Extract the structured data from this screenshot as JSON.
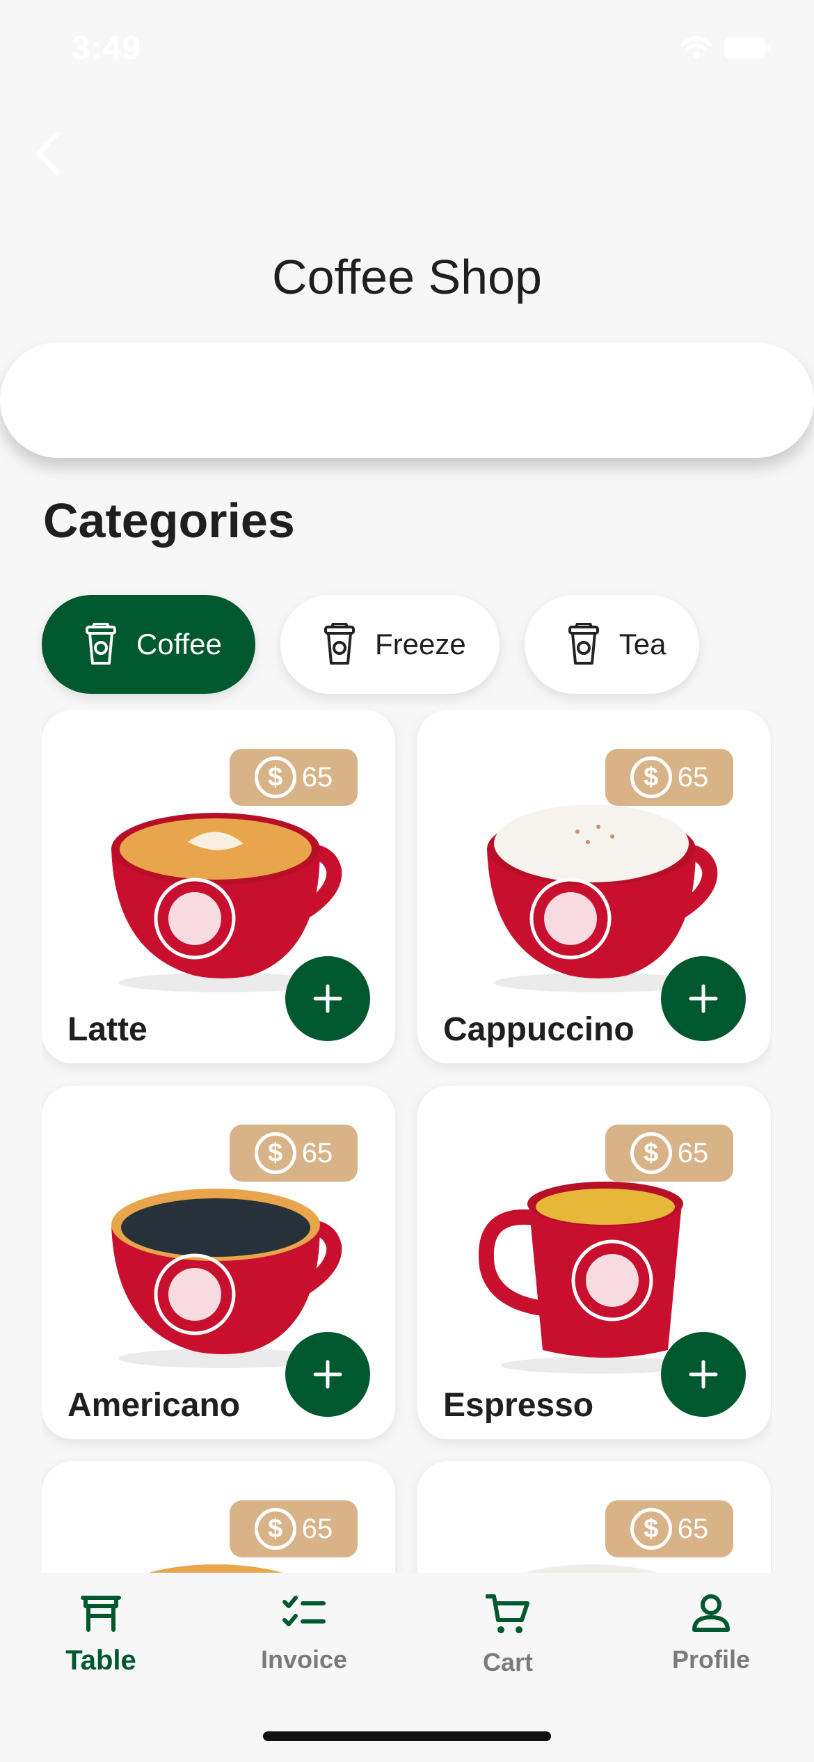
{
  "status_bar": {
    "time": "3:49"
  },
  "header": {
    "title": "Coffee Shop"
  },
  "search": {
    "placeholder": ""
  },
  "categories": {
    "title": "Categories",
    "items": [
      {
        "label": "Coffee",
        "active": true
      },
      {
        "label": "Freeze",
        "active": false
      },
      {
        "label": "Tea",
        "active": false
      }
    ]
  },
  "products": [
    {
      "name": "Latte",
      "price": "65"
    },
    {
      "name": "Cappuccino",
      "price": "65"
    },
    {
      "name": "Americano",
      "price": "65"
    },
    {
      "name": "Espresso",
      "price": "65"
    },
    {
      "name": "",
      "price": "65"
    },
    {
      "name": "",
      "price": "65"
    }
  ],
  "tab_bar": {
    "items": [
      {
        "label": "Table",
        "icon": "table-icon",
        "active": true
      },
      {
        "label": "Invoice",
        "icon": "checklist-icon",
        "active": false
      },
      {
        "label": "Cart",
        "icon": "cart-icon",
        "active": false
      },
      {
        "label": "Profile",
        "icon": "person-icon",
        "active": false
      }
    ]
  },
  "colors": {
    "brand": "#00582e",
    "price_badge": "#d4a878",
    "cup": "#c8102e"
  }
}
